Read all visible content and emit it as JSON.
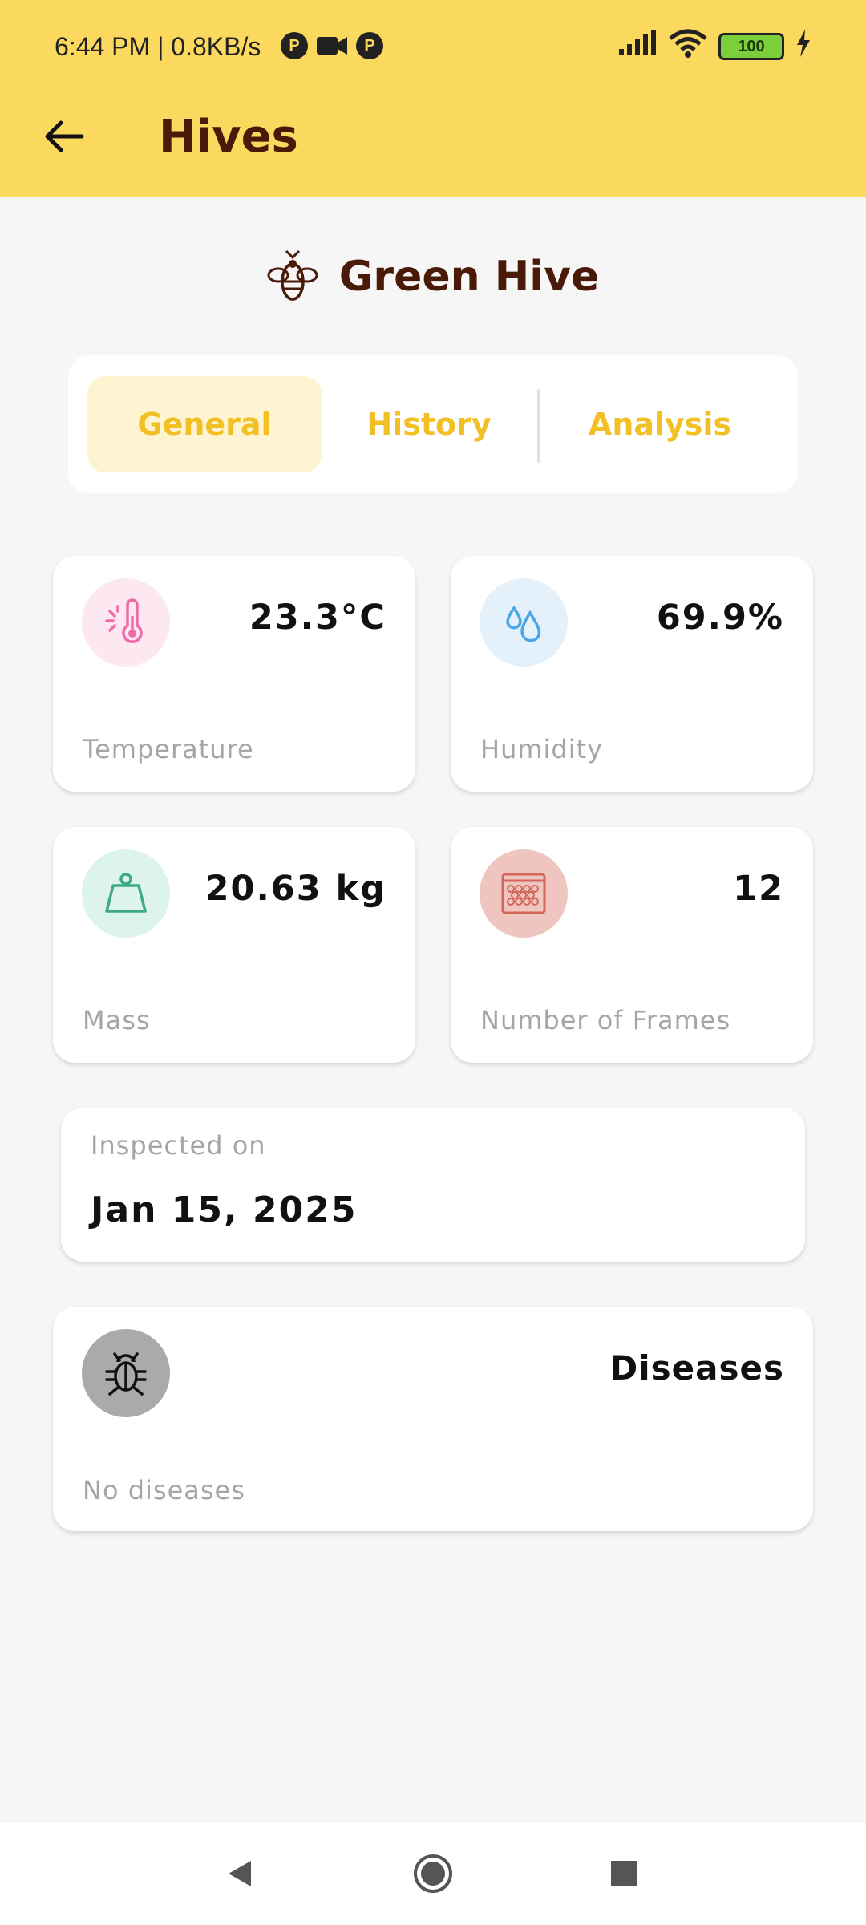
{
  "status_bar": {
    "time": "6:44 PM | 0.8KB/s",
    "battery": "100"
  },
  "app_bar": {
    "title": "Hives"
  },
  "hive": {
    "name": "Green Hive"
  },
  "tabs": [
    {
      "label": "General",
      "active": true
    },
    {
      "label": "History",
      "active": false
    },
    {
      "label": "Analysis",
      "active": false
    }
  ],
  "metrics": {
    "temperature": {
      "value": "23.3°C",
      "label": "Temperature",
      "icon": "thermometer-icon",
      "color": "#f06aa8",
      "bg": "#fde8f2"
    },
    "humidity": {
      "value": "69.9%",
      "label": "Humidity",
      "icon": "droplets-icon",
      "color": "#4aa6e6",
      "bg": "#e4f1fb"
    },
    "mass": {
      "value": "20.63 kg",
      "label": "Mass",
      "icon": "weight-icon",
      "color": "#3fa985",
      "bg": "#dcf4ea"
    },
    "frames": {
      "value": "12",
      "label": "Number of Frames",
      "icon": "honeycomb-frame-icon",
      "color": "#d2665a",
      "bg": "#efc5bf"
    }
  },
  "inspection": {
    "label": "Inspected on",
    "date": "Jan 15, 2025"
  },
  "diseases": {
    "title": "Diseases",
    "text": "No diseases",
    "icon": "bug-icon"
  },
  "colors": {
    "accent": "#fbd95f",
    "tab_text": "#f2c025",
    "title_brown": "#4a1a08"
  }
}
